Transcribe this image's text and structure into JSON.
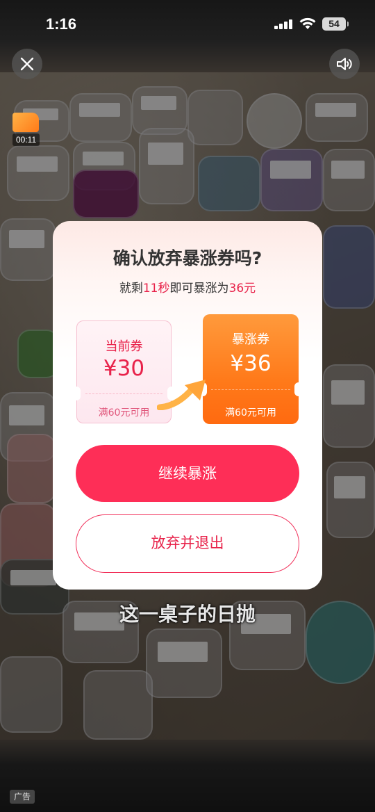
{
  "status_bar": {
    "time": "1:16",
    "battery": "54"
  },
  "video": {
    "elapsed": "00:11",
    "subtitle": "这一桌子的日抛",
    "ad_label": "广告"
  },
  "dialog": {
    "title": "确认放弃暴涨券吗?",
    "subtitle_prefix": "就剩",
    "subtitle_time": "11秒",
    "subtitle_mid": "即可暴涨为",
    "subtitle_amount": "36元",
    "current_coupon": {
      "label": "当前券",
      "amount": "¥30",
      "condition": "满60元可用"
    },
    "boost_coupon": {
      "label": "暴涨券",
      "amount": "¥36",
      "condition": "满60元可用"
    },
    "continue_button": "继续暴涨",
    "quit_button": "放弃并退出"
  },
  "colors": {
    "accent_red": "#fe2e57",
    "coupon_orange": "#ff7a1a"
  },
  "icons": {
    "close": "close-icon",
    "sound": "speaker-icon",
    "arrow": "curved-arrow-icon"
  }
}
